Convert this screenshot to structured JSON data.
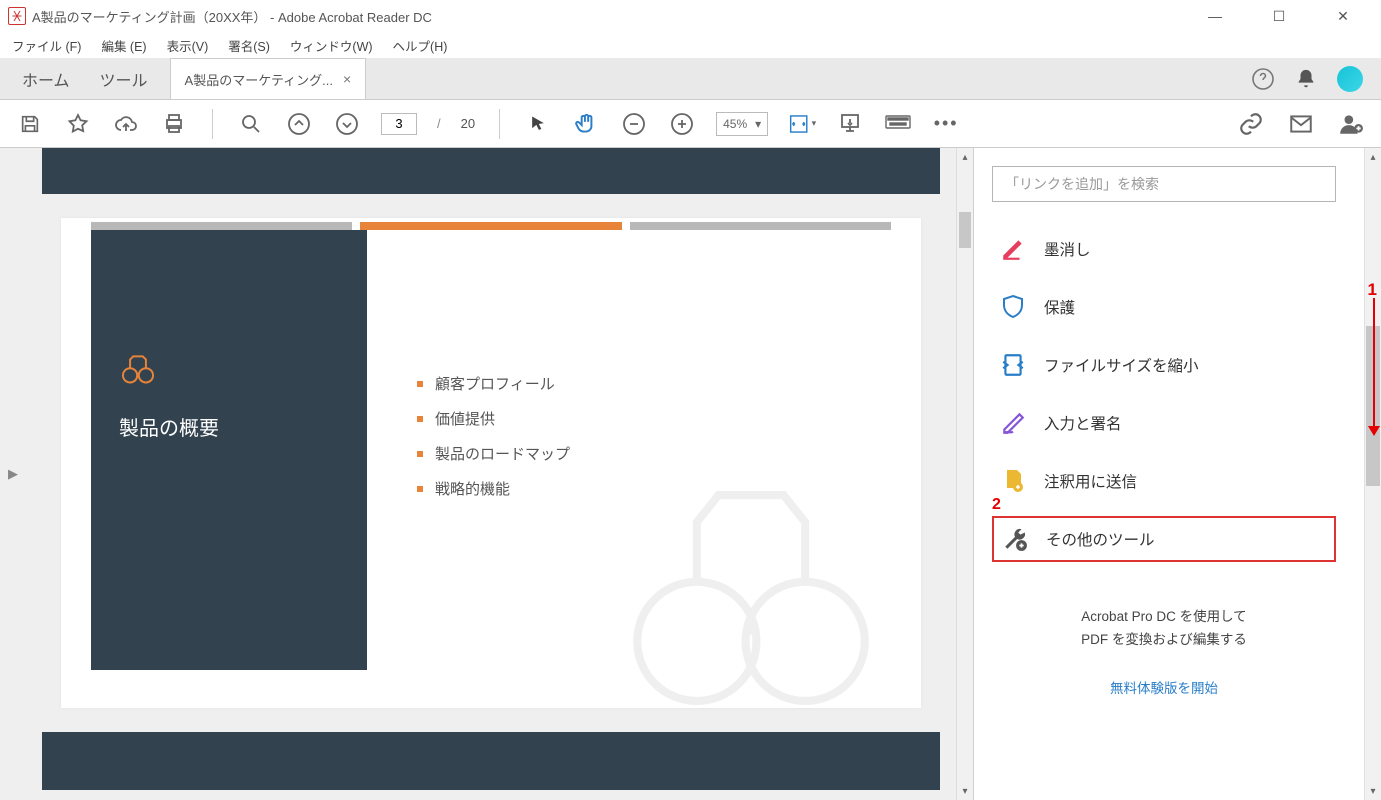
{
  "window": {
    "title": "A製品のマーケティング計画（20XX年） - Adobe Acrobat Reader DC"
  },
  "menu": {
    "file": "ファイル (F)",
    "edit": "編集 (E)",
    "view": "表示(V)",
    "sign": "署名(S)",
    "window": "ウィンドウ(W)",
    "help": "ヘルプ(H)"
  },
  "tabs": {
    "home": "ホーム",
    "tools": "ツール",
    "doc": "A製品のマーケティング..."
  },
  "toolbar": {
    "page": "3",
    "pages": "20",
    "pagesep": "/",
    "zoom": "45%"
  },
  "doc": {
    "heading": "製品の概要",
    "bullets": [
      "顧客プロフィール",
      "価値提供",
      "製品のロードマップ",
      "戦略的機能"
    ]
  },
  "rpanel": {
    "search_placeholder": "「リンクを追加」を検索",
    "tools": [
      {
        "label": "墨消し"
      },
      {
        "label": "保護"
      },
      {
        "label": "ファイルサイズを縮小"
      },
      {
        "label": "入力と署名"
      },
      {
        "label": "注釈用に送信"
      },
      {
        "label": "その他のツール"
      }
    ],
    "promo1": "Acrobat Pro DC を使用して",
    "promo2": "PDF を変換および編集する",
    "promo_link": "無料体験版を開始"
  },
  "ann": {
    "n1": "1",
    "n2": "2"
  }
}
